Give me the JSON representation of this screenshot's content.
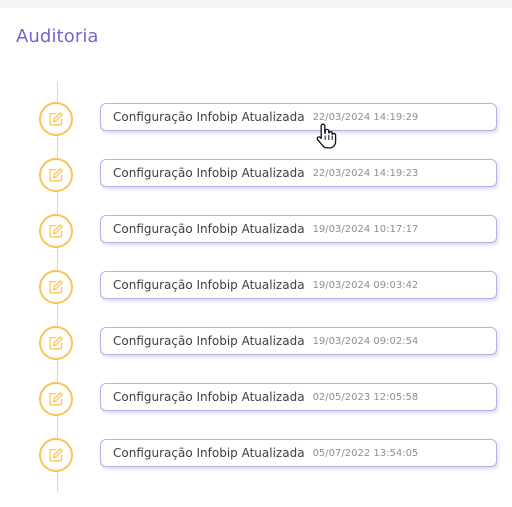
{
  "header": {
    "title": "Auditoria"
  },
  "colors": {
    "accent": "#7b61d6",
    "icon_ring": "#f6c65b",
    "card_border": "#b9b2ea"
  },
  "icon": "edit-icon",
  "entries": [
    {
      "title": "Configuração Infobip Atualizada",
      "timestamp": "22/03/2024 14:19:29"
    },
    {
      "title": "Configuração Infobip Atualizada",
      "timestamp": "22/03/2024 14:19:23"
    },
    {
      "title": "Configuração Infobip Atualizada",
      "timestamp": "19/03/2024 10:17:17"
    },
    {
      "title": "Configuração Infobip Atualizada",
      "timestamp": "19/03/2024 09:03:42"
    },
    {
      "title": "Configuração Infobip Atualizada",
      "timestamp": "19/03/2024 09:02:54"
    },
    {
      "title": "Configuração Infobip Atualizada",
      "timestamp": "02/05/2023 12:05:58"
    },
    {
      "title": "Configuração Infobip Atualizada",
      "timestamp": "05/07/2022 13:54:05"
    }
  ]
}
